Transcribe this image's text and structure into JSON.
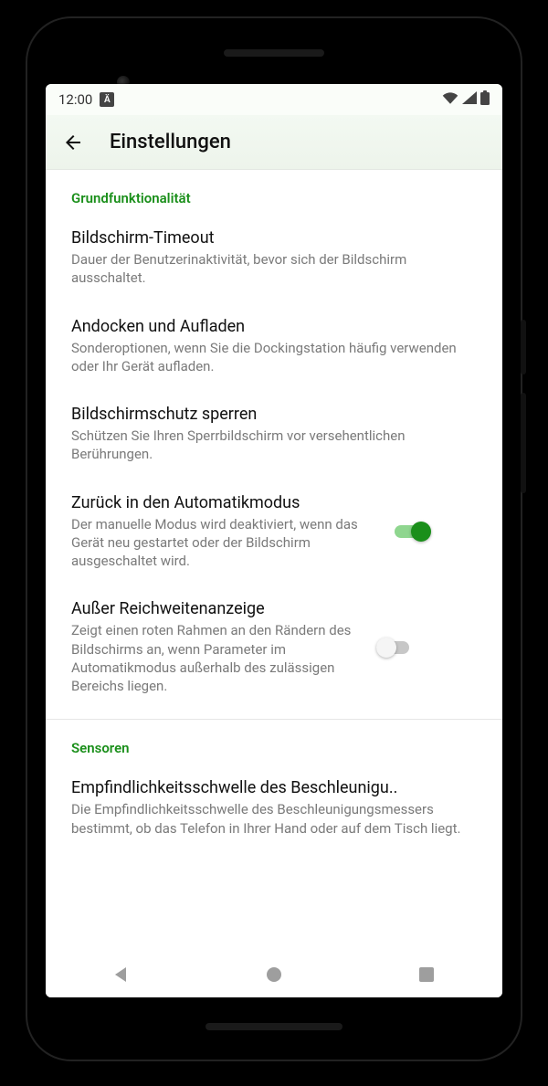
{
  "status": {
    "time": "12:00",
    "lang": "Ä"
  },
  "appbar": {
    "title": "Einstellungen"
  },
  "sections": {
    "basic": {
      "header": "Grundfunktionalität"
    },
    "sensors": {
      "header": "Sensoren"
    }
  },
  "settings": {
    "timeout": {
      "title": "Bildschirm-Timeout",
      "sub": "Dauer der Benutzerinaktivität, bevor sich der Bildschirm ausschaltet."
    },
    "dock": {
      "title": "Andocken und Aufladen",
      "sub": "Sonderoptionen, wenn Sie die Dockingstation häufig verwenden oder Ihr Gerät aufladen."
    },
    "lock": {
      "title": "Bildschirmschutz sperren",
      "sub": "Schützen Sie Ihren Sperrbildschirm vor versehentlichen Berührungen."
    },
    "auto": {
      "title": "Zurück in den Automatikmodus",
      "sub": "Der manuelle Modus wird deaktiviert, wenn das Gerät neu gestartet oder der Bildschirm ausgeschaltet wird."
    },
    "range": {
      "title": "Außer Reichweitenanzeige",
      "sub": "Zeigt einen roten Rahmen an den Rändern des Bildschirms an, wenn Parameter im Automatikmodus außerhalb des zulässigen Bereichs liegen."
    },
    "accel": {
      "title": "Empfindlichkeitsschwelle des Beschleunigu..",
      "sub": "Die Empfindlichkeitsschwelle des Beschleunigungsmessers bestimmt, ob das Telefon in Ihrer Hand oder auf dem Tisch liegt."
    }
  }
}
